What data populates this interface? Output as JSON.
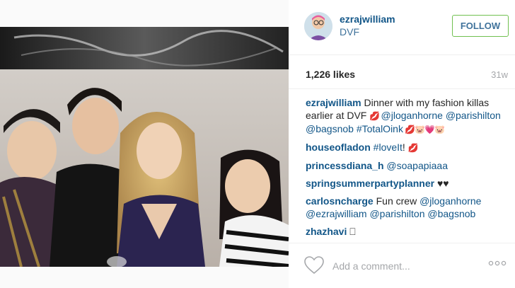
{
  "post": {
    "username": "ezrajwilliam",
    "location": "DVF",
    "follow_label": "FOLLOW",
    "likes": "1,226 likes",
    "timestamp": "31w"
  },
  "comments": [
    {
      "user": "ezrajwilliam",
      "parts": [
        {
          "t": "text",
          "v": " Dinner with my fashion killas earlier at DVF "
        },
        {
          "t": "emoji",
          "v": "💋 "
        },
        {
          "t": "mention",
          "v": "@jloganhorne"
        },
        {
          "t": "text",
          "v": " "
        },
        {
          "t": "mention",
          "v": "@parishilton"
        },
        {
          "t": "text",
          "v": " "
        },
        {
          "t": "mention",
          "v": "@bagsnob"
        },
        {
          "t": "text",
          "v": " "
        },
        {
          "t": "mention",
          "v": "#TotalOink"
        },
        {
          "t": "emoji",
          "v": " 💋🐷💗🐷"
        }
      ]
    },
    {
      "user": "houseofladon",
      "parts": [
        {
          "t": "text",
          "v": " "
        },
        {
          "t": "mention",
          "v": "#loveIt"
        },
        {
          "t": "text",
          "v": "! "
        },
        {
          "t": "emoji",
          "v": "💋"
        }
      ]
    },
    {
      "user": "princessdiana_h",
      "parts": [
        {
          "t": "text",
          "v": " "
        },
        {
          "t": "mention",
          "v": "@soapapiaaa"
        }
      ]
    },
    {
      "user": "springsummerpartyplanner",
      "parts": [
        {
          "t": "text",
          "v": " ♥♥"
        }
      ]
    },
    {
      "user": "carlosncharge",
      "parts": [
        {
          "t": "text",
          "v": " Fun crew "
        },
        {
          "t": "mention",
          "v": "@jloganhorne"
        },
        {
          "t": "text",
          "v": " "
        },
        {
          "t": "mention",
          "v": "@ezrajwilliam"
        },
        {
          "t": "text",
          "v": " "
        },
        {
          "t": "mention",
          "v": "@parishilton"
        },
        {
          "t": "text",
          "v": " "
        },
        {
          "t": "mention",
          "v": "@bagsnob"
        }
      ]
    },
    {
      "user": "zhazhavi",
      "parts": [
        {
          "t": "text",
          "v": " ⎕"
        }
      ]
    }
  ],
  "add_comment_placeholder": "Add a comment...",
  "icons": {
    "like": "heart-outline-icon",
    "more": "more-options-icon"
  },
  "colors": {
    "username": "#125688",
    "link": "#3f729b",
    "follow_border": "#70c050",
    "muted": "#a5a7aa"
  }
}
